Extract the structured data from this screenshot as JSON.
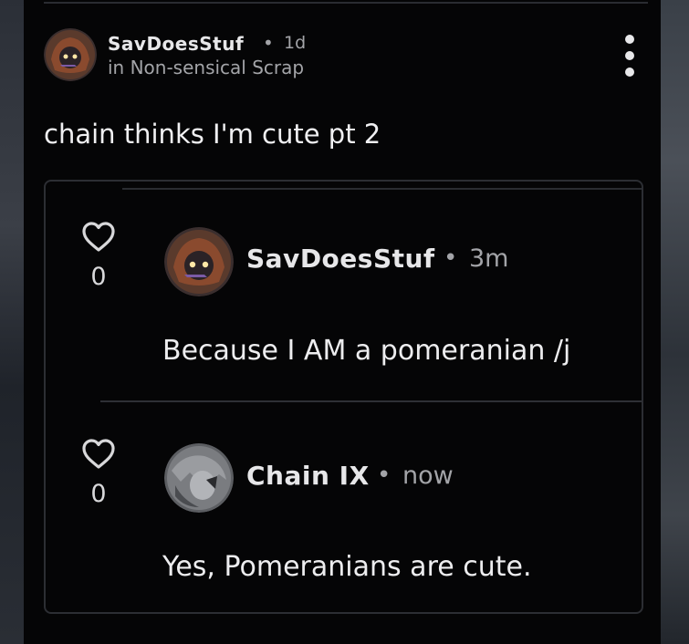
{
  "post": {
    "author": "SavDoesStuf",
    "separator": "•",
    "time": "1d",
    "community": "in Non-sensical Scrap",
    "title": "chain thinks I'm cute pt 2"
  },
  "comments": [
    {
      "author": "SavDoesStuf",
      "separator": "•",
      "time": "3m",
      "likes": "0",
      "body": "Because I AM a pomeranian /j"
    },
    {
      "author": "Chain IX",
      "separator": "•",
      "time": "now",
      "likes": "0",
      "body": "Yes, Pomeranians are cute."
    }
  ],
  "icons": {
    "more": "more-vertical-icon",
    "like": "heart-outline-icon"
  },
  "colors": {
    "background": "#050506",
    "primary_text": "#e7e7e9",
    "secondary_text": "#a3a4a8",
    "border": "#2c2e33"
  }
}
